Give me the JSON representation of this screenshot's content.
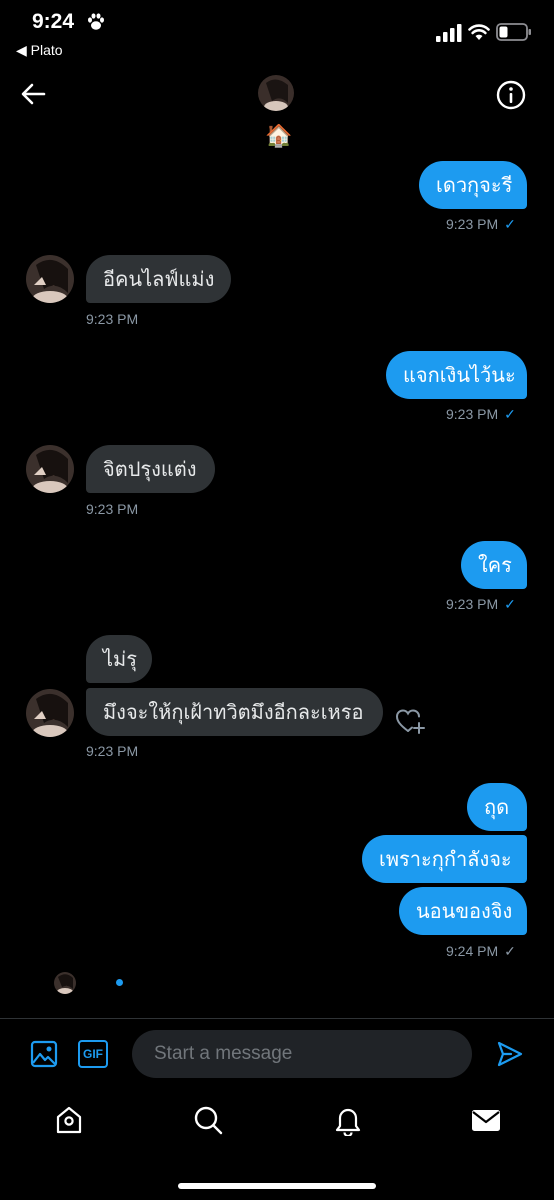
{
  "status_bar": {
    "time": "9:24",
    "back_app": "◀ Plato"
  },
  "header": {
    "name": "🏠",
    "back_icon": "arrow-left-icon",
    "info_icon": "info-icon"
  },
  "messages": [
    {
      "side": "sent",
      "text": "เดวกุจะรี",
      "time": "9:23 PM",
      "read": true
    },
    {
      "side": "received",
      "text": "อีคนไลฟ์แม่ง",
      "time": "9:23 PM"
    },
    {
      "side": "sent",
      "text": "แจกเงินไว้นะ",
      "time": "9:23 PM",
      "read": true
    },
    {
      "side": "received",
      "text": "จิตปรุงแต่ง",
      "time": "9:23 PM"
    },
    {
      "side": "sent",
      "text": "ใคร",
      "time": "9:23 PM",
      "read": true
    },
    {
      "side": "received",
      "texts": [
        "ไม่รุ",
        "มึงจะให้กุเฝ้าทวิตมึงอีกละเหรอ"
      ],
      "time": "9:23 PM"
    },
    {
      "side": "sent",
      "texts": [
        "ถุด",
        "เพราะกุกำลังจะ",
        "นอนของจิง"
      ],
      "time": "9:24 PM",
      "read": false
    }
  ],
  "compose": {
    "placeholder": "Start a message",
    "gif_label": "GIF"
  },
  "tabs": [
    "home-icon",
    "search-icon",
    "notifications-icon",
    "messages-icon"
  ],
  "colors": {
    "accent": "#1d9bf0",
    "received_bubble": "#2f3336",
    "background": "#000000"
  }
}
